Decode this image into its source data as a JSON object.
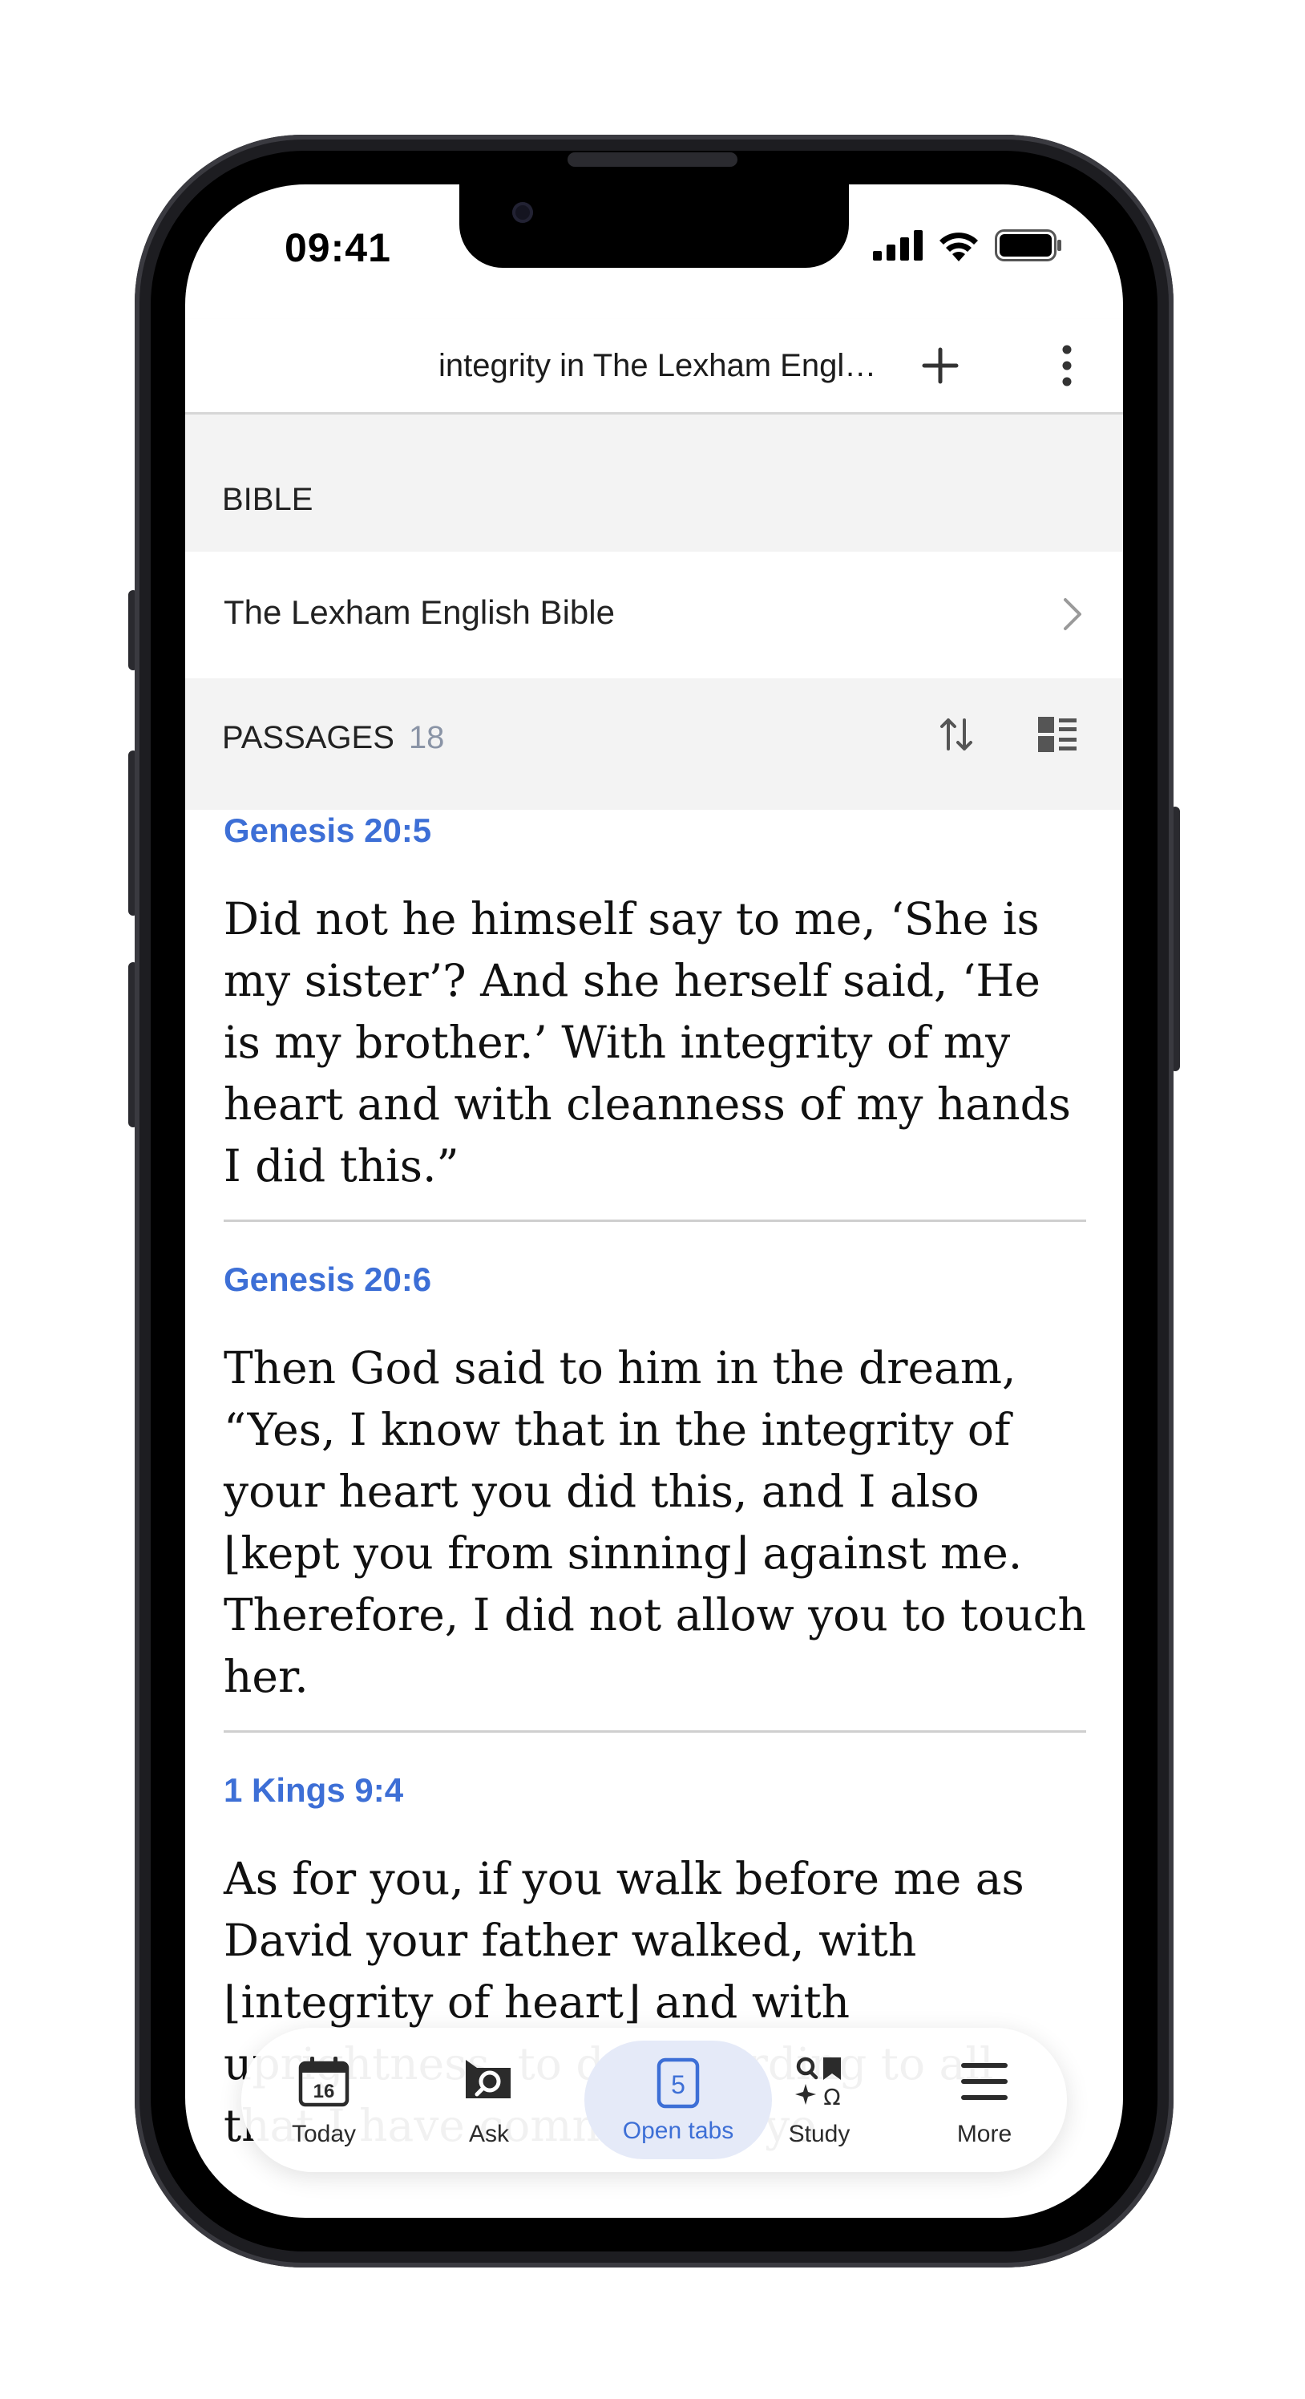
{
  "status": {
    "time": "09:41"
  },
  "header": {
    "title": "integrity in The Lexham Engl…"
  },
  "bible_section": {
    "label": "BIBLE",
    "selected_bible": "The Lexham English Bible"
  },
  "passages_section": {
    "label": "PASSAGES",
    "count": "18"
  },
  "passages": [
    {
      "ref": "Genesis 20:5",
      "text": "Did not he himself say to me, ‘She is my sister’? And she herself said, ‘He is my brother.’ With integrity of my heart and with cleanness of my hands I did this.”"
    },
    {
      "ref": "Genesis 20:6",
      "text": "Then God said to him in the dream, “Yes, I know that in the integrity of your heart you did this, and I also ⌊kept you from sinning⌋ against me. Therefore, I did not allow you to touch her."
    },
    {
      "ref": "1 Kings 9:4",
      "text": "As for you, if you walk before me as David your father walked, with ⌊integrity of heart⌋ and with uprightness, to do according to all that I have commanded yo"
    }
  ],
  "bottom_nav": {
    "today_day": "16",
    "today": "Today",
    "ask": "Ask",
    "tabs_count": "5",
    "open_tabs": "Open tabs",
    "study": "Study",
    "more": "More"
  },
  "colors": {
    "accent": "#3d6fd6",
    "section_bg": "#f3f3f3"
  }
}
